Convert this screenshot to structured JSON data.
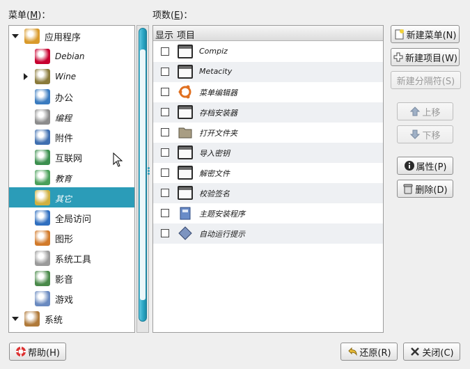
{
  "labels": {
    "menus_prefix": "菜单(",
    "menus_key": "M",
    "menus_suffix": ")：",
    "items_prefix": "项数(",
    "items_key": "E",
    "items_suffix": ")："
  },
  "tree": [
    {
      "label": "应用程序",
      "level": 0,
      "expander": "down",
      "italic": false,
      "icon": "applications-icon",
      "color": "#d99a2b"
    },
    {
      "label": "Debian",
      "level": 1,
      "expander": "",
      "italic": true,
      "icon": "debian-icon",
      "color": "#c7002f"
    },
    {
      "label": "Wine",
      "level": 1,
      "expander": "right",
      "italic": true,
      "icon": "wine-icon",
      "color": "#8a7a3a"
    },
    {
      "label": "办公",
      "level": 1,
      "expander": "",
      "italic": false,
      "icon": "office-icon",
      "color": "#3a7bbf"
    },
    {
      "label": "编程",
      "level": 1,
      "expander": "",
      "italic": true,
      "icon": "programming-icon",
      "color": "#8c8c8c"
    },
    {
      "label": "附件",
      "level": 1,
      "expander": "",
      "italic": false,
      "icon": "accessories-icon",
      "color": "#3f6fb0"
    },
    {
      "label": "互联网",
      "level": 1,
      "expander": "",
      "italic": false,
      "icon": "internet-icon",
      "color": "#3b8f4e"
    },
    {
      "label": "教育",
      "level": 1,
      "expander": "",
      "italic": true,
      "icon": "education-icon",
      "color": "#4aa05a"
    },
    {
      "label": "其它",
      "level": 1,
      "expander": "",
      "italic": true,
      "icon": "other-icon",
      "color": "#d0b040",
      "selected": true
    },
    {
      "label": "全局访问",
      "level": 1,
      "expander": "",
      "italic": false,
      "icon": "accessibility-icon",
      "color": "#2f6fc0"
    },
    {
      "label": "图形",
      "level": 1,
      "expander": "",
      "italic": false,
      "icon": "graphics-icon",
      "color": "#d27a2a"
    },
    {
      "label": "系统工具",
      "level": 1,
      "expander": "",
      "italic": false,
      "icon": "system-tools-icon",
      "color": "#9a9a9a"
    },
    {
      "label": "影音",
      "level": 1,
      "expander": "",
      "italic": false,
      "icon": "multimedia-icon",
      "color": "#4a8a4a"
    },
    {
      "label": "游戏",
      "level": 1,
      "expander": "",
      "italic": false,
      "icon": "games-icon",
      "color": "#6a8ac0"
    },
    {
      "label": "系统",
      "level": 0,
      "expander": "down",
      "italic": false,
      "icon": "system-icon",
      "color": "#b07a3a"
    }
  ],
  "list": {
    "col_show": "显示",
    "col_item": "项目",
    "rows": [
      {
        "label": "Compiz",
        "icon": "window-icon"
      },
      {
        "label": "Metacity",
        "icon": "window-icon"
      },
      {
        "label": "菜单编辑器",
        "icon": "ubuntu-icon"
      },
      {
        "label": "存档安装器",
        "icon": "window-icon"
      },
      {
        "label": "打开文件夹",
        "icon": "folder-icon"
      },
      {
        "label": "导入密钥",
        "icon": "window-icon"
      },
      {
        "label": "解密文件",
        "icon": "window-icon"
      },
      {
        "label": "校验签名",
        "icon": "window-icon"
      },
      {
        "label": "主题安装程序",
        "icon": "theme-installer-icon"
      },
      {
        "label": "自动运行提示",
        "icon": "autorun-icon"
      }
    ]
  },
  "buttons": {
    "new_menu": "新建菜单(N)",
    "new_item": "新建项目(W)",
    "new_separator": "新建分隔符(S)",
    "move_up": "上移",
    "move_down": "下移",
    "properties": "属性(P)",
    "delete": "删除(D)",
    "help": "帮助(H)",
    "revert": "还原(R)",
    "close": "关闭(C)"
  }
}
